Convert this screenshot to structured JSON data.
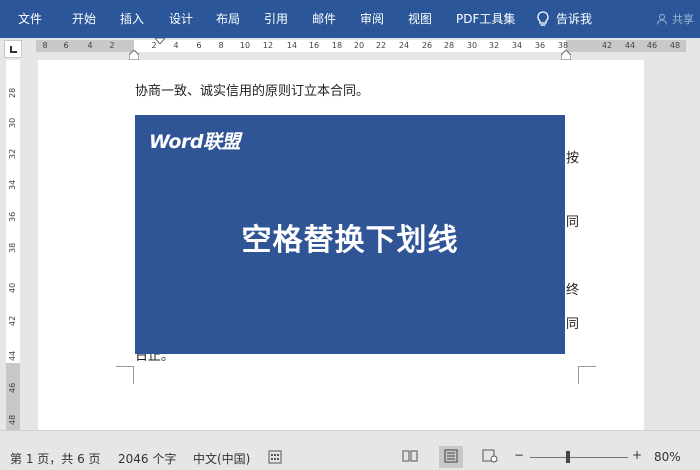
{
  "ribbon": {
    "tabs": [
      "文件",
      "开始",
      "插入",
      "设计",
      "布局",
      "引用",
      "邮件",
      "审阅",
      "视图",
      "PDF工具集"
    ],
    "tell_me": "告诉我",
    "share": "共享"
  },
  "ruler": {
    "h_labels": [
      "8",
      "6",
      "4",
      "2",
      "2",
      "4",
      "6",
      "8",
      "10",
      "12",
      "14",
      "16",
      "18",
      "20",
      "22",
      "24",
      "26",
      "28",
      "30",
      "32",
      "34",
      "36",
      "38",
      "42",
      "44",
      "46",
      "48"
    ],
    "v_labels": [
      "28",
      "30",
      "32",
      "34",
      "36",
      "38",
      "40",
      "42",
      "44",
      "46",
      "48"
    ]
  },
  "document": {
    "line1": "协商一致、诚实信用的原则订立本合同。",
    "fragments": [
      "按",
      "同",
      "终",
      "同",
      "日止。"
    ]
  },
  "banner": {
    "brand": "Word联盟",
    "headline": "空格替换下划线"
  },
  "status": {
    "page": "第 1 页，共 6 页",
    "words": "2046 个字",
    "language": "中文(中国)",
    "zoom": "80%",
    "zoom_minus": "−",
    "zoom_plus": "+"
  },
  "colors": {
    "ribbon": "#2b579a",
    "banner": "#2f5597"
  }
}
